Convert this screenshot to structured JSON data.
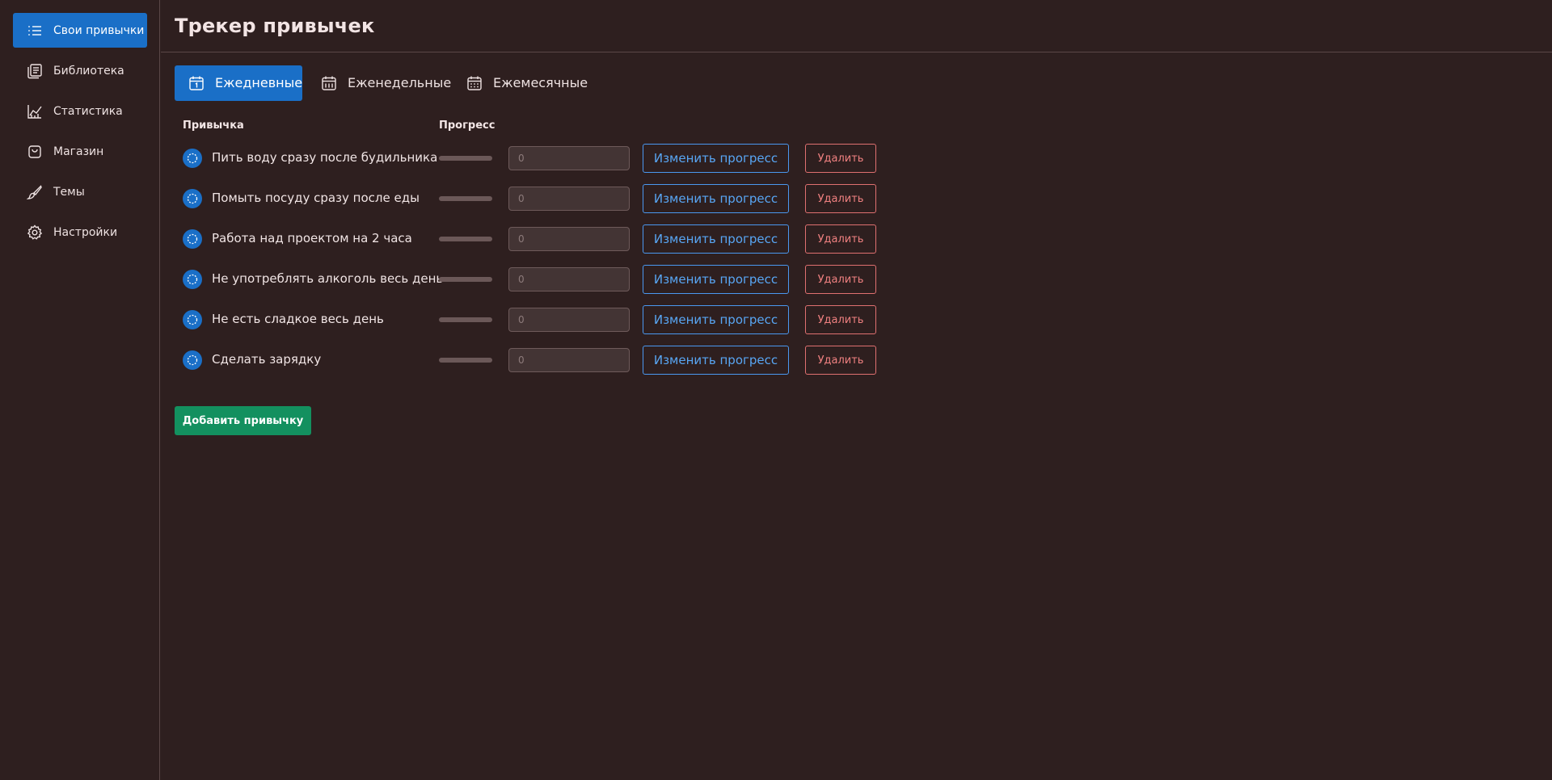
{
  "theme": {
    "accent": "#1a6fc7",
    "background": "#2e1f1f",
    "success": "#13905f",
    "danger": "#e07070",
    "link": "#58a6f4"
  },
  "sidebar": {
    "items": [
      {
        "label": "Свои привычки",
        "icon": "list-icon",
        "active": true
      },
      {
        "label": "Библиотека",
        "icon": "library-icon",
        "active": false
      },
      {
        "label": "Статистика",
        "icon": "chart-icon",
        "active": false
      },
      {
        "label": "Магазин",
        "icon": "shopping-bag-icon",
        "active": false
      },
      {
        "label": "Темы",
        "icon": "paintbrush-icon",
        "active": false
      },
      {
        "label": "Настройки",
        "icon": "gear-icon",
        "active": false
      }
    ]
  },
  "header": {
    "title": "Трекер привычек"
  },
  "tabs": [
    {
      "label": "Ежедневные",
      "icon": "calendar-day-icon",
      "active": true
    },
    {
      "label": "Еженедельные",
      "icon": "calendar-week-icon",
      "active": false
    },
    {
      "label": "Ежемесячные",
      "icon": "calendar-month-icon",
      "active": false
    }
  ],
  "table": {
    "headers": {
      "habit": "Привычка",
      "progress": "Прогресс"
    },
    "rows": [
      {
        "name": "Пить воду сразу после будильника",
        "progress": 0,
        "input_placeholder": "0",
        "edit_label": "Изменить прогресс",
        "delete_label": "Удалить"
      },
      {
        "name": "Помыть посуду сразу после еды",
        "progress": 0,
        "input_placeholder": "0",
        "edit_label": "Изменить прогресс",
        "delete_label": "Удалить"
      },
      {
        "name": "Работа над проектом на 2 часа",
        "progress": 0,
        "input_placeholder": "0",
        "edit_label": "Изменить прогресс",
        "delete_label": "Удалить"
      },
      {
        "name": "Не употреблять алкоголь весь день",
        "progress": 0,
        "input_placeholder": "0",
        "edit_label": "Изменить прогресс",
        "delete_label": "Удалить"
      },
      {
        "name": "Не есть сладкое весь день",
        "progress": 0,
        "input_placeholder": "0",
        "edit_label": "Изменить прогресс",
        "delete_label": "Удалить"
      },
      {
        "name": "Сделать зарядку",
        "progress": 0,
        "input_placeholder": "0",
        "edit_label": "Изменить прогресс",
        "delete_label": "Удалить"
      }
    ]
  },
  "add_button": {
    "label": "Добавить привычку"
  }
}
